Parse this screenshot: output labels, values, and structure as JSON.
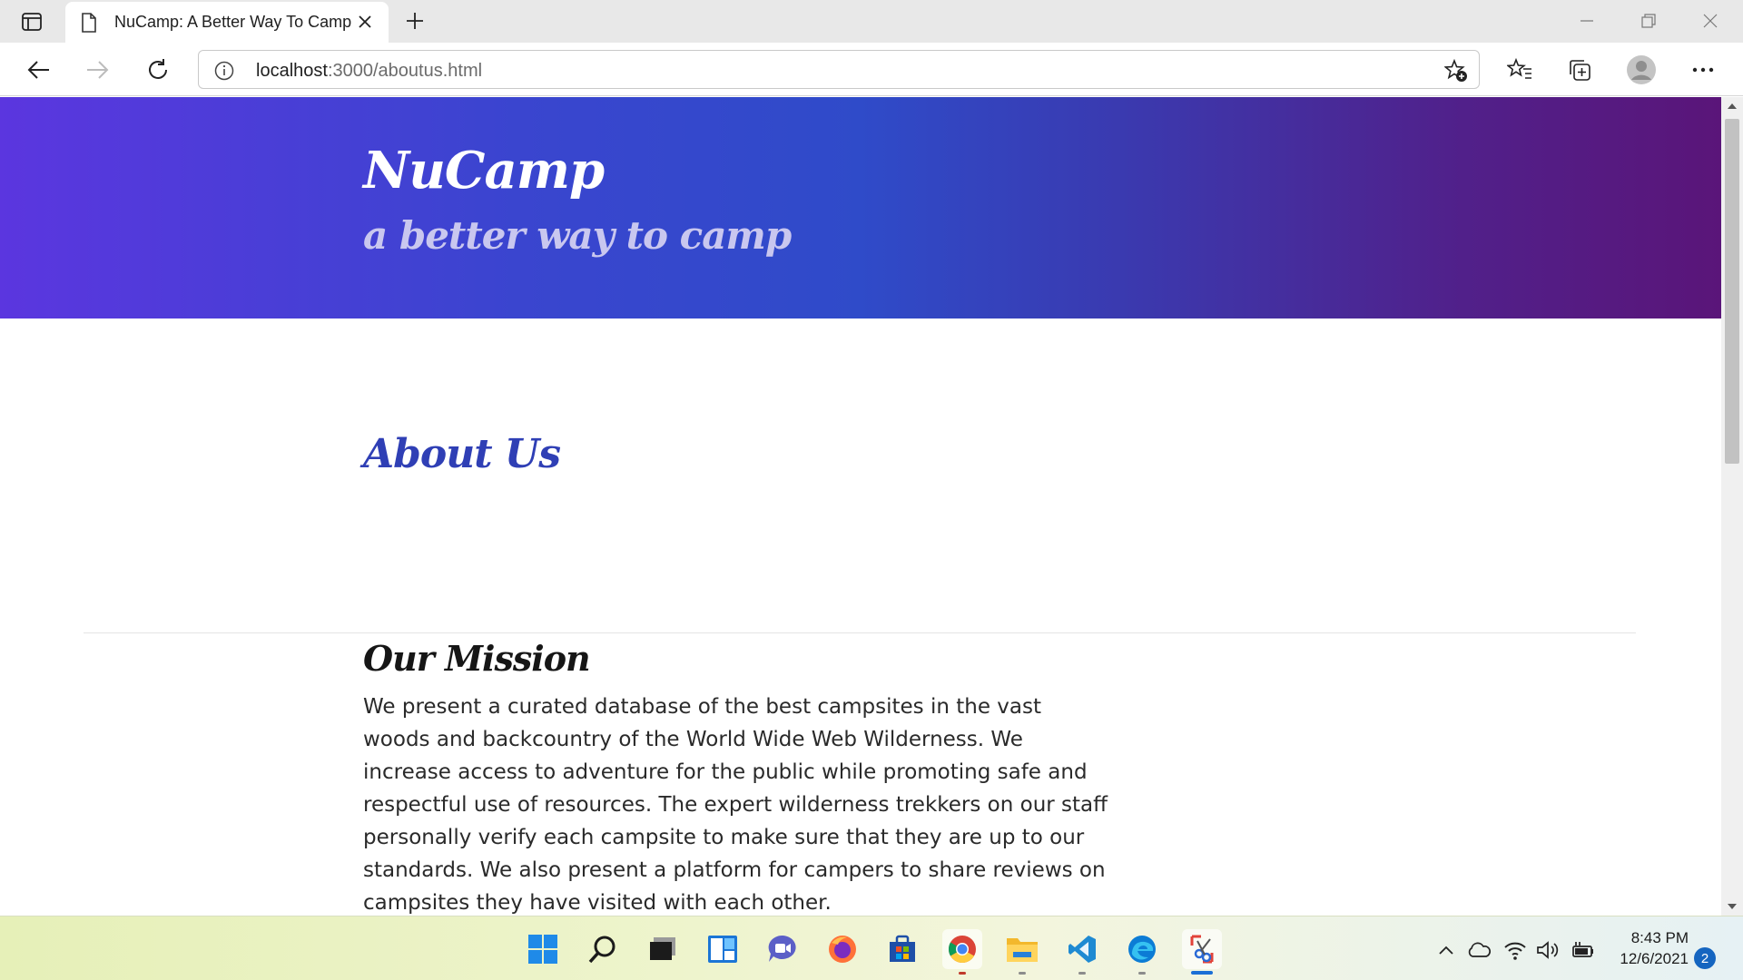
{
  "browser": {
    "tab_title": "NuCamp: A Better Way To Camp",
    "url_host": "localhost",
    "url_rest": ":3000/aboutus.html"
  },
  "page": {
    "brand": "NuCamp",
    "tagline": "a better way to camp",
    "about_title": "About Us",
    "mission_title": "Our Mission",
    "mission_text": "We present a curated database of the best campsites in the vast woods and backcountry of the World Wide Web Wilderness. We increase access to adventure for the public while promoting safe and respectful use of resources. The expert wilderness trekkers on our staff personally verify each campsite to make sure that they are up to our standards. We also present a platform for campers to share reviews on campsites they have visited with each other."
  },
  "taskbar": {
    "apps": [
      "start-icon",
      "search-icon",
      "task-view-icon",
      "widgets-icon",
      "chat-icon",
      "firefox-icon",
      "store-icon",
      "chrome-icon",
      "file-explorer-icon",
      "vscode-icon",
      "edge-icon",
      "snipping-tool-icon"
    ],
    "time": "8:43 PM",
    "date": "12/6/2021",
    "notification_count": "2"
  },
  "colors": {
    "heading_blue": "#2f3fb5",
    "jumbotron_start": "#5b36df",
    "jumbotron_end": "#5a1579"
  }
}
